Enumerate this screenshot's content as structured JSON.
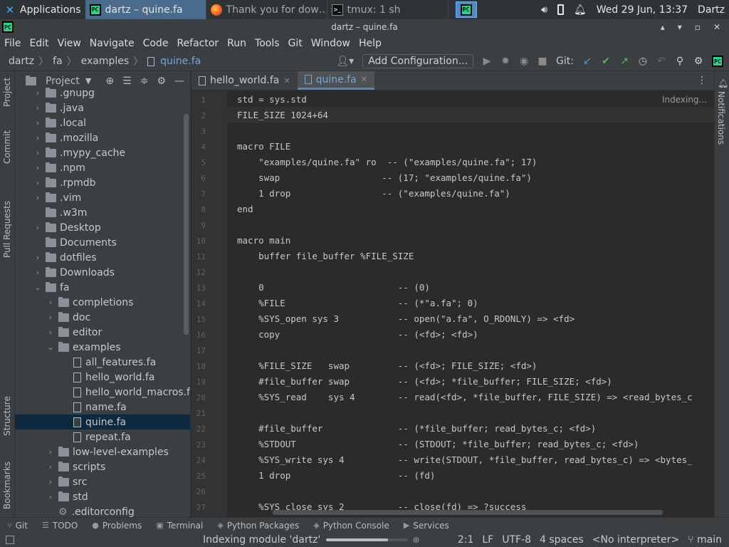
{
  "os_panel": {
    "applications": "Applications",
    "tasks": [
      {
        "label": "dartz – quine.fa",
        "icon": "pycharm-icon",
        "active": true
      },
      {
        "label": "Thank you for dow…",
        "icon": "firefox-icon",
        "active": false
      },
      {
        "label": "tmux: 1 sh",
        "icon": "terminal-icon",
        "active": false
      }
    ],
    "clock": "Wed 29 Jun, 13:37",
    "user": "Dartz"
  },
  "window": {
    "title": "dartz – quine.fa"
  },
  "menu": [
    "File",
    "Edit",
    "View",
    "Navigate",
    "Code",
    "Refactor",
    "Run",
    "Tools",
    "Git",
    "Window",
    "Help"
  ],
  "breadcrumb": [
    "dartz",
    "fa",
    "examples",
    "quine.fa"
  ],
  "toolbar": {
    "add_configuration": "Add Configuration...",
    "git_label": "Git:"
  },
  "left_stripe": [
    "Project",
    "Commit",
    "Pull Requests",
    "Structure",
    "Bookmarks"
  ],
  "right_stripe": [
    "Notifications"
  ],
  "project_panel": {
    "title": "Project",
    "tree": [
      {
        "label": ".gnupg",
        "depth": 0,
        "kind": "folder",
        "arrow": "›"
      },
      {
        "label": ".java",
        "depth": 0,
        "kind": "folder",
        "arrow": "›"
      },
      {
        "label": ".local",
        "depth": 0,
        "kind": "folder",
        "arrow": "›"
      },
      {
        "label": ".mozilla",
        "depth": 0,
        "kind": "folder",
        "arrow": "›"
      },
      {
        "label": ".mypy_cache",
        "depth": 0,
        "kind": "folder",
        "arrow": "›"
      },
      {
        "label": ".npm",
        "depth": 0,
        "kind": "folder",
        "arrow": "›"
      },
      {
        "label": ".rpmdb",
        "depth": 0,
        "kind": "folder",
        "arrow": "›"
      },
      {
        "label": ".vim",
        "depth": 0,
        "kind": "folder",
        "arrow": "›"
      },
      {
        "label": ".w3m",
        "depth": 0,
        "kind": "folder",
        "arrow": ""
      },
      {
        "label": "Desktop",
        "depth": 0,
        "kind": "folder",
        "arrow": "›"
      },
      {
        "label": "Documents",
        "depth": 0,
        "kind": "folder",
        "arrow": ""
      },
      {
        "label": "dotfiles",
        "depth": 0,
        "kind": "folder",
        "arrow": "›"
      },
      {
        "label": "Downloads",
        "depth": 0,
        "kind": "folder",
        "arrow": "›"
      },
      {
        "label": "fa",
        "depth": 0,
        "kind": "folder",
        "arrow": "⌄"
      },
      {
        "label": "completions",
        "depth": 1,
        "kind": "folder",
        "arrow": "›"
      },
      {
        "label": "doc",
        "depth": 1,
        "kind": "folder",
        "arrow": "›"
      },
      {
        "label": "editor",
        "depth": 1,
        "kind": "folder",
        "arrow": "›"
      },
      {
        "label": "examples",
        "depth": 1,
        "kind": "folder",
        "arrow": "⌄"
      },
      {
        "label": "all_features.fa",
        "depth": 2,
        "kind": "file",
        "arrow": ""
      },
      {
        "label": "hello_world.fa",
        "depth": 2,
        "kind": "file",
        "arrow": ""
      },
      {
        "label": "hello_world_macros.f",
        "depth": 2,
        "kind": "file",
        "arrow": ""
      },
      {
        "label": "name.fa",
        "depth": 2,
        "kind": "file",
        "arrow": ""
      },
      {
        "label": "quine.fa",
        "depth": 2,
        "kind": "file",
        "arrow": "",
        "selected": true
      },
      {
        "label": "repeat.fa",
        "depth": 2,
        "kind": "file",
        "arrow": ""
      },
      {
        "label": "low-level-examples",
        "depth": 1,
        "kind": "folder",
        "arrow": "›"
      },
      {
        "label": "scripts",
        "depth": 1,
        "kind": "folder",
        "arrow": "›"
      },
      {
        "label": "src",
        "depth": 1,
        "kind": "folder",
        "arrow": "›"
      },
      {
        "label": "std",
        "depth": 1,
        "kind": "folder",
        "arrow": "›"
      },
      {
        "label": ".editorconfig",
        "depth": 1,
        "kind": "config",
        "arrow": ""
      }
    ]
  },
  "editor": {
    "tabs": [
      {
        "label": "hello_world.fa",
        "active": false
      },
      {
        "label": "quine.fa",
        "active": true
      }
    ],
    "indexing_note": "Indexing...",
    "lines": [
      "std = sys.std",
      "FILE_SIZE 1024+64",
      "",
      "macro FILE",
      "    \"examples/quine.fa\" ro  -- (\"examples/quine.fa\"; 17)",
      "    swap                   -- (17; \"examples/quine.fa\")",
      "    1 drop                 -- (\"examples/quine.fa\")",
      "end",
      "",
      "macro main",
      "    buffer file_buffer %FILE_SIZE",
      "",
      "    0                         -- (0)",
      "    %FILE                     -- (*\"a.fa\"; 0)",
      "    %SYS_open sys 3           -- open(\"a.fa\", O_RDONLY) => <fd>",
      "    copy                      -- (<fd>; <fd>)",
      "",
      "    %FILE_SIZE   swap         -- (<fd>; FILE_SIZE; <fd>)",
      "    #file_buffer swap         -- (<fd>; *file_buffer; FILE_SIZE; <fd>)",
      "    %SYS_read    sys 4        -- read(<fd>, *file_buffer, FILE_SIZE) => <read_bytes_c",
      "",
      "    #file_buffer              -- (*file_buffer; read_bytes_c; <fd>)",
      "    %STDOUT                   -- (STDOUT; *file_buffer; read_bytes_c; <fd>)",
      "    %SYS_write sys 4          -- write(STDOUT, *file_buffer, read_bytes_c) => <bytes_",
      "    1 drop                    -- (fd)",
      "",
      "    %SYS_close sys 2          -- close(fd) => ?success"
    ]
  },
  "bottom_tools": [
    "Git",
    "TODO",
    "Problems",
    "Terminal",
    "Python Packages",
    "Python Console",
    "Services"
  ],
  "status": {
    "message": "Indexing module 'dartz'",
    "progress_fraction": 0.75,
    "position": "2:1",
    "line_sep": "LF",
    "encoding": "UTF-8",
    "indent": "4 spaces",
    "interpreter": "<No interpreter>",
    "branch": "main"
  }
}
